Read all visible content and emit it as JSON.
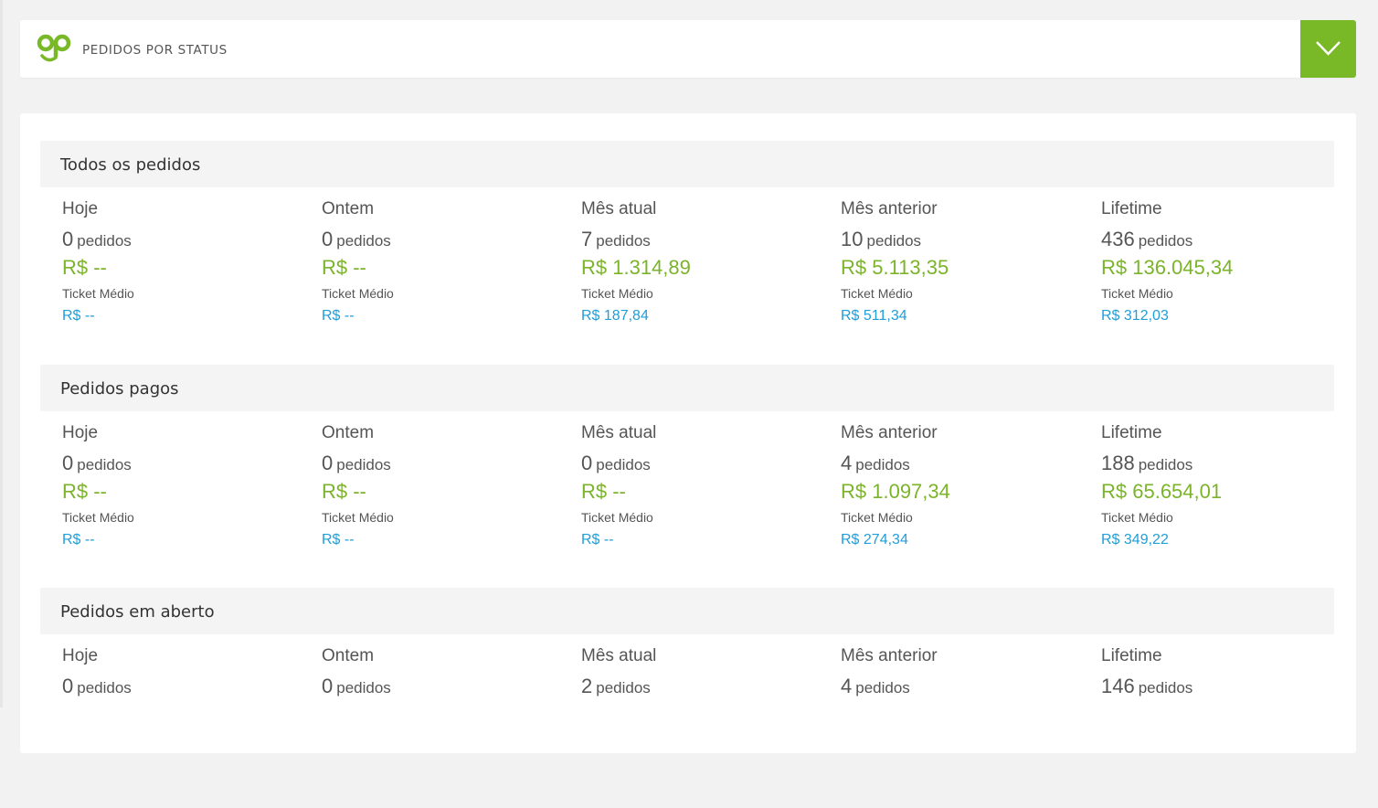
{
  "header": {
    "title": "PEDIDOS POR STATUS",
    "logo_icon": "op-logo-icon",
    "toggle_icon": "chevron-down-icon",
    "accent_color": "#79b928"
  },
  "colors": {
    "revenue": "#7bb42a",
    "ticket": "#1f9ed8"
  },
  "labels": {
    "pedidos": "pedidos",
    "ticket_medio": "Ticket Médio"
  },
  "sections": [
    {
      "title": "Todos os pedidos",
      "columns": [
        {
          "period": "Hoje",
          "count": "0",
          "unit": "pedidos",
          "revenue": "R$ --",
          "ticket_label": "Ticket Médio",
          "ticket": "R$ --"
        },
        {
          "period": "Ontem",
          "count": "0",
          "unit": "pedidos",
          "revenue": "R$ --",
          "ticket_label": "Ticket Médio",
          "ticket": "R$ --"
        },
        {
          "period": "Mês atual",
          "count": "7",
          "unit": "pedidos",
          "revenue": "R$ 1.314,89",
          "ticket_label": "Ticket Médio",
          "ticket": "R$ 187,84"
        },
        {
          "period": "Mês anterior",
          "count": "10",
          "unit": "pedidos",
          "revenue": "R$ 5.113,35",
          "ticket_label": "Ticket Médio",
          "ticket": "R$ 511,34"
        },
        {
          "period": "Lifetime",
          "count": "436",
          "unit": "pedidos",
          "revenue": "R$ 136.045,34",
          "ticket_label": "Ticket Médio",
          "ticket": "R$ 312,03"
        }
      ]
    },
    {
      "title": "Pedidos pagos",
      "columns": [
        {
          "period": "Hoje",
          "count": "0",
          "unit": "pedidos",
          "revenue": "R$ --",
          "ticket_label": "Ticket Médio",
          "ticket": "R$ --"
        },
        {
          "period": "Ontem",
          "count": "0",
          "unit": "pedidos",
          "revenue": "R$ --",
          "ticket_label": "Ticket Médio",
          "ticket": "R$ --"
        },
        {
          "period": "Mês atual",
          "count": "0",
          "unit": "pedidos",
          "revenue": "R$ --",
          "ticket_label": "Ticket Médio",
          "ticket": "R$ --"
        },
        {
          "period": "Mês anterior",
          "count": "4",
          "unit": "pedidos",
          "revenue": "R$ 1.097,34",
          "ticket_label": "Ticket Médio",
          "ticket": "R$ 274,34"
        },
        {
          "period": "Lifetime",
          "count": "188",
          "unit": "pedidos",
          "revenue": "R$ 65.654,01",
          "ticket_label": "Ticket Médio",
          "ticket": "R$ 349,22"
        }
      ]
    },
    {
      "title": "Pedidos em aberto",
      "columns": [
        {
          "period": "Hoje",
          "count": "0",
          "unit": "pedidos"
        },
        {
          "period": "Ontem",
          "count": "0",
          "unit": "pedidos"
        },
        {
          "period": "Mês atual",
          "count": "2",
          "unit": "pedidos"
        },
        {
          "period": "Mês anterior",
          "count": "4",
          "unit": "pedidos"
        },
        {
          "period": "Lifetime",
          "count": "146",
          "unit": "pedidos"
        }
      ]
    }
  ]
}
